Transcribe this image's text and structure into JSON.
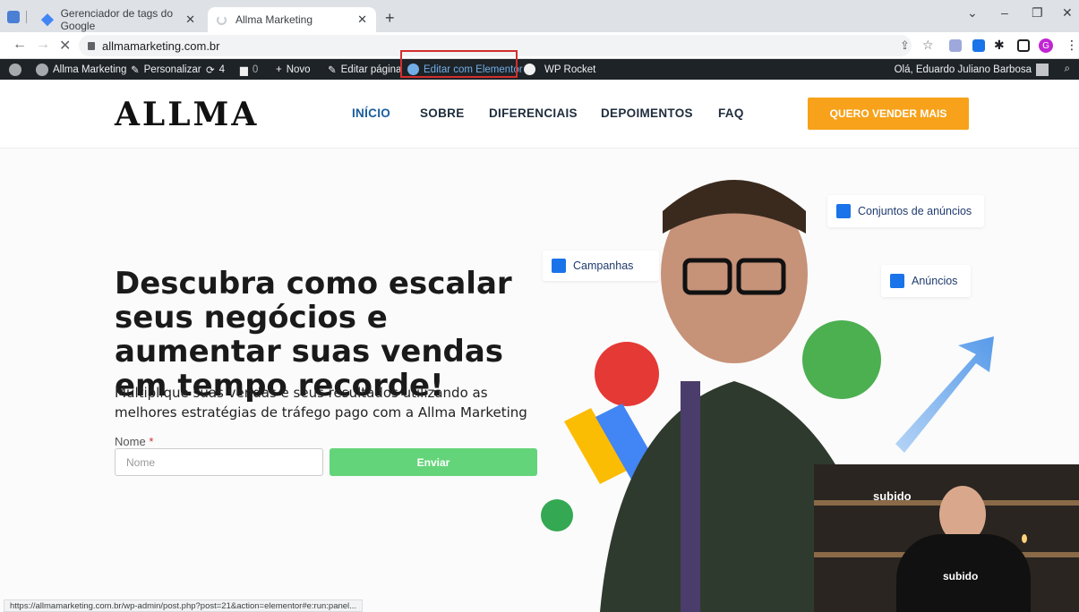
{
  "browser": {
    "tabs": [
      {
        "label": "Gerenciador de tags do Google"
      },
      {
        "label": "Allma Marketing"
      }
    ],
    "url": "allmamarketing.com.br",
    "status_url": "https://allmamarketing.com.br/wp-admin/post.php?post=21&action=elementor#e:run:panel..."
  },
  "wp_admin": {
    "site_name": "Allma Marketing",
    "customize": "Personalizar",
    "updates": "4",
    "comments": "0",
    "new": "Novo",
    "edit_page": "Editar página",
    "edit_elementor": "Editar com Elementor",
    "wp_rocket": "WP Rocket",
    "greeting": "Olá, Eduardo Juliano Barbosa"
  },
  "site": {
    "logo": "ALLMA",
    "nav": [
      "INÍCIO",
      "SOBRE",
      "DIFERENCIAIS",
      "DEPOIMENTOS",
      "FAQ"
    ],
    "cta": "QUERO VENDER MAIS"
  },
  "hero": {
    "headline": "Descubra como escalar seus negócios e aumentar suas vendas em tempo recorde!",
    "subheadline": "Multiplique suas vendas e seus resultados utilizando as melhores estratégias de tráfego pago com a Allma Marketing",
    "form_label": "Nome",
    "required_mark": "*",
    "input_placeholder": "Nome",
    "submit": "Enviar",
    "chips": [
      "Campanhas",
      "Conjuntos de anúncios",
      "Anúncios"
    ]
  },
  "webcam": {
    "sign_text": "subido",
    "shirt_text": "subido"
  },
  "colors": {
    "wp_bar": "#1d2327",
    "cta": "#f7a21a",
    "submit": "#63d47a",
    "nav_active": "#1b5e9e",
    "highlight_box": "#d32f2f"
  }
}
